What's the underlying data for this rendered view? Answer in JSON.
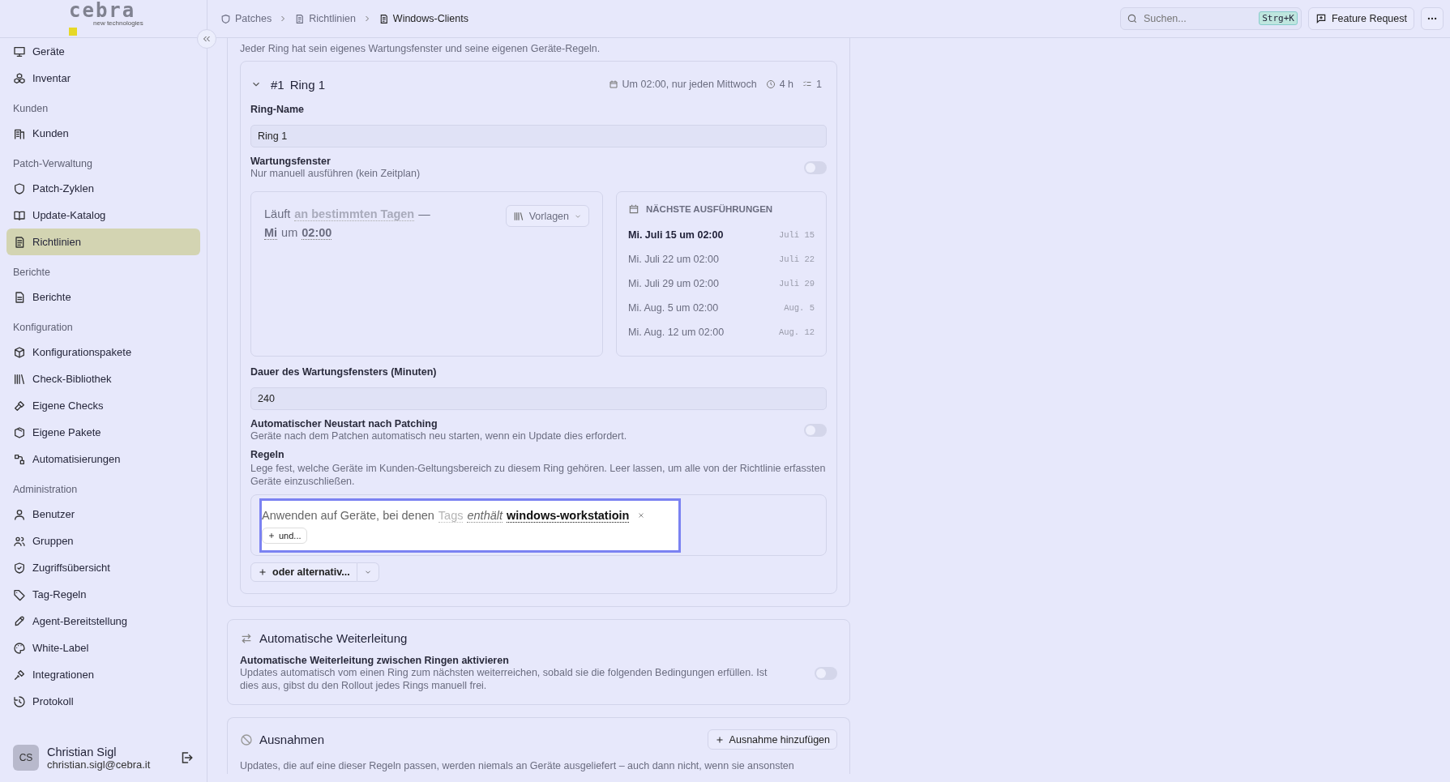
{
  "sidebar": {
    "logo": {
      "wordmark": "cebra",
      "tagline": "new technologies"
    },
    "sections": [
      {
        "items": [
          {
            "label": "Geräte",
            "selected": false
          },
          {
            "label": "Inventar",
            "selected": false
          }
        ]
      },
      {
        "title": "Kunden",
        "items": [
          {
            "label": "Kunden",
            "selected": false
          }
        ]
      },
      {
        "title": "Patch-Verwaltung",
        "items": [
          {
            "label": "Patch-Zyklen",
            "selected": false
          },
          {
            "label": "Update-Katalog",
            "selected": false
          },
          {
            "label": "Richtlinien",
            "selected": true
          }
        ]
      },
      {
        "title": "Berichte",
        "items": [
          {
            "label": "Berichte",
            "selected": false
          }
        ]
      },
      {
        "title": "Konfiguration",
        "items": [
          {
            "label": "Konfigurationspakete",
            "selected": false
          },
          {
            "label": "Check-Bibliothek",
            "selected": false
          },
          {
            "label": "Eigene Checks",
            "selected": false
          },
          {
            "label": "Eigene Pakete",
            "selected": false
          },
          {
            "label": "Automatisierungen",
            "selected": false
          }
        ]
      },
      {
        "title": "Administration",
        "items": [
          {
            "label": "Benutzer",
            "selected": false
          },
          {
            "label": "Gruppen",
            "selected": false
          },
          {
            "label": "Zugriffsübersicht",
            "selected": false
          },
          {
            "label": "Tag-Regeln",
            "selected": false
          },
          {
            "label": "Agent-Bereitstellung",
            "selected": false
          },
          {
            "label": "White-Label",
            "selected": false
          },
          {
            "label": "Integrationen",
            "selected": false
          },
          {
            "label": "Protokoll",
            "selected": false
          }
        ]
      }
    ],
    "user": {
      "initials": "CS",
      "name": "Christian Sigl",
      "email": "christian.sigl@cebra.it"
    }
  },
  "header": {
    "breadcrumbs": [
      "Patches",
      "Richtlinien",
      "Windows-Clients"
    ],
    "search": {
      "placeholder": "Suchen...",
      "shortcut": "Strg+K"
    },
    "feature_button": "Feature Request"
  },
  "rings_intro": "Jeder Ring hat sein eigenes Wartungsfenster und seine eigenen Geräte-Regeln.",
  "ring": {
    "expanded": true,
    "number": "#1",
    "name": "Ring 1",
    "schedule_summary": "Um 02:00, nur jeden Mittwoch",
    "duration_summary": "4 h",
    "rules_count": "1",
    "name_label": "Ring-Name",
    "name_value": "Ring 1",
    "window": {
      "label": "Wartungsfenster",
      "hint": "Nur manuell ausführen (kein Zeitplan)",
      "on": false
    },
    "schedule_sentence": [
      {
        "kind": "plain",
        "text": "Läuft"
      },
      {
        "kind": "choice",
        "text": "an bestimmten Tagen"
      },
      {
        "kind": "plain",
        "text": "—"
      },
      {
        "kind": "value",
        "text": "Mi"
      },
      {
        "kind": "plain",
        "text": "um"
      },
      {
        "kind": "value",
        "text": "02:00"
      }
    ],
    "templates_button": "Vorlagen",
    "next_runs": {
      "title": "NÄCHSTE AUSFÜHRUNGEN",
      "items": [
        {
          "label": "Mi. Juli 15 um 02:00",
          "short": "Juli 15",
          "selected": true
        },
        {
          "label": "Mi. Juli 22 um 02:00",
          "short": "Juli 22",
          "selected": false
        },
        {
          "label": "Mi. Juli 29 um 02:00",
          "short": "Juli 29",
          "selected": false
        },
        {
          "label": "Mi. Aug. 5 um 02:00",
          "short": "Aug. 5",
          "selected": false
        },
        {
          "label": "Mi. Aug. 12 um 02:00",
          "short": "Aug. 12",
          "selected": false
        }
      ]
    },
    "duration_label": "Dauer des Wartungsfensters (Minuten)",
    "duration_value": "240",
    "reboot": {
      "label": "Automatischer Neustart nach Patching",
      "hint": "Geräte nach dem Patchen automatisch neu starten, wenn ein Update dies erfordert.",
      "on": false
    },
    "rules": {
      "label": "Regeln",
      "hint": "Lege fest, welche Geräte im Kunden-Geltungsbereich zu diesem Ring gehören. Leer lassen, um alle von der Richtlinie erfassten Geräte einzuschließen.",
      "sentence": "Anwenden auf Geräte, bei denen",
      "field": "Tags",
      "operator": "enthält",
      "value": "windows-workstatioin",
      "and_button": "und...",
      "or_button": "oder alternativ..."
    }
  },
  "forwarding": {
    "title": "Automatische Weiterleitung",
    "label": "Automatische Weiterleitung zwischen Ringen aktivieren",
    "hint": "Updates automatisch vom einen Ring zum nächsten weiterreichen, sobald sie die folgenden Bedingungen erfüllen. Ist dies aus, gibst du den Rollout jedes Rings manuell frei.",
    "on": false
  },
  "exceptions": {
    "title": "Ausnahmen",
    "add_button": "Ausnahme hinzufügen",
    "hint": "Updates, die auf eine dieser Regeln passen, werden niemals an Geräte ausgeliefert – auch dann nicht, wenn sie ansonsten"
  }
}
